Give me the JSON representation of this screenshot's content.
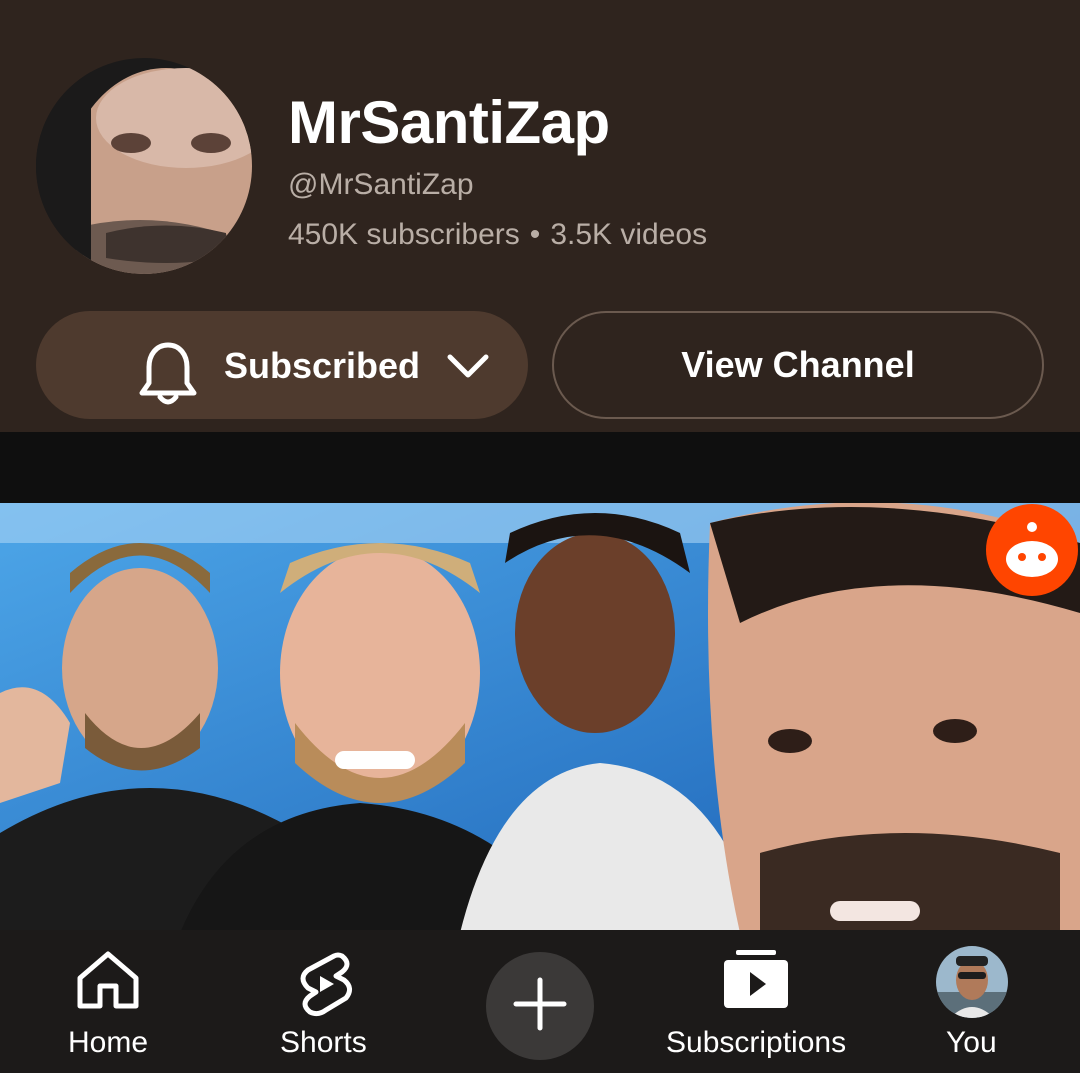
{
  "channel": {
    "name": "MrSantiZap",
    "handle": "@MrSantiZap",
    "subscribers": "450K subscribers",
    "separator": "•",
    "videos": "3.5K videos"
  },
  "buttons": {
    "subscribed_label": "Subscribed",
    "view_channel_label": "View Channel"
  },
  "thumbnail": {
    "badge_icon": "reddit-icon"
  },
  "nav": {
    "items": [
      {
        "label": "Home",
        "icon": "home-icon"
      },
      {
        "label": "Shorts",
        "icon": "shorts-icon"
      },
      {
        "label": "",
        "icon": "plus-icon"
      },
      {
        "label": "Subscriptions",
        "icon": "subscriptions-icon"
      },
      {
        "label": "You",
        "icon": "avatar"
      }
    ]
  },
  "colors": {
    "header_bg": "#2f241e",
    "subscribed_bg": "#4e3a2e",
    "reddit_orange": "#ff4500"
  }
}
